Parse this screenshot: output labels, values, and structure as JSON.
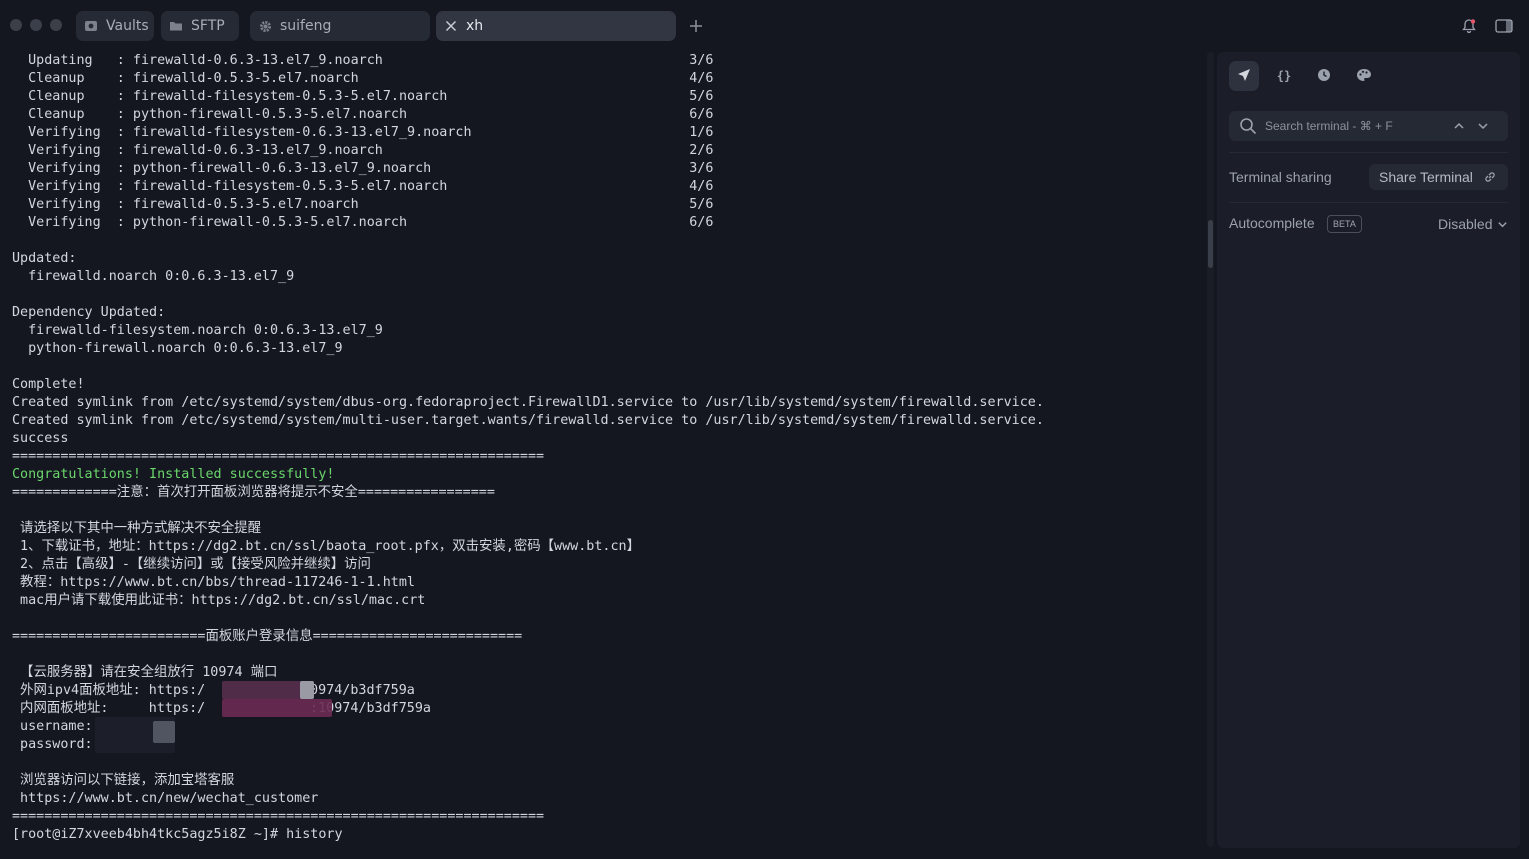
{
  "tabs": [
    {
      "label": "Vaults",
      "icon": "vault-icon"
    },
    {
      "label": "SFTP",
      "icon": "folder-icon"
    },
    {
      "label": "suifeng",
      "icon": "gear-icon"
    },
    {
      "label": "xh",
      "icon": "close-icon",
      "active": true
    }
  ],
  "terminal": {
    "lines": [
      {
        "text": "  Updating   : firewalld-0.6.3-13.el7_9.noarch                                      3/6"
      },
      {
        "text": "  Cleanup    : firewalld-0.5.3-5.el7.noarch                                         4/6"
      },
      {
        "text": "  Cleanup    : firewalld-filesystem-0.5.3-5.el7.noarch                              5/6"
      },
      {
        "text": "  Cleanup    : python-firewall-0.5.3-5.el7.noarch                                   6/6"
      },
      {
        "text": "  Verifying  : firewalld-filesystem-0.6.3-13.el7_9.noarch                           1/6"
      },
      {
        "text": "  Verifying  : firewalld-0.6.3-13.el7_9.noarch                                      2/6"
      },
      {
        "text": "  Verifying  : python-firewall-0.6.3-13.el7_9.noarch                                3/6"
      },
      {
        "text": "  Verifying  : firewalld-filesystem-0.5.3-5.el7.noarch                              4/6"
      },
      {
        "text": "  Verifying  : firewalld-0.5.3-5.el7.noarch                                         5/6"
      },
      {
        "text": "  Verifying  : python-firewall-0.5.3-5.el7.noarch                                   6/6"
      },
      {
        "text": ""
      },
      {
        "text": "Updated:"
      },
      {
        "text": "  firewalld.noarch 0:0.6.3-13.el7_9"
      },
      {
        "text": ""
      },
      {
        "text": "Dependency Updated:"
      },
      {
        "text": "  firewalld-filesystem.noarch 0:0.6.3-13.el7_9"
      },
      {
        "text": "  python-firewall.noarch 0:0.6.3-13.el7_9"
      },
      {
        "text": ""
      },
      {
        "text": "Complete!"
      },
      {
        "text": "Created symlink from /etc/systemd/system/dbus-org.fedoraproject.FirewallD1.service to /usr/lib/systemd/system/firewalld.service."
      },
      {
        "text": "Created symlink from /etc/systemd/system/multi-user.target.wants/firewalld.service to /usr/lib/systemd/system/firewalld.service."
      },
      {
        "text": "success"
      },
      {
        "text": "=================================================================="
      },
      {
        "text": "Congratulations! Installed successfully!",
        "color": "#6bd66b"
      },
      {
        "text": "=============注意：首次打开面板浏览器将提示不安全================="
      },
      {
        "text": ""
      },
      {
        "text": " 请选择以下其中一种方式解决不安全提醒"
      },
      {
        "text": " 1、下载证书，地址：https://dg2.bt.cn/ssl/baota_root.pfx，双击安装,密码【www.bt.cn】"
      },
      {
        "text": " 2、点击【高级】-【继续访问】或【接受风险并继续】访问"
      },
      {
        "text": " 教程：https://www.bt.cn/bbs/thread-117246-1-1.html"
      },
      {
        "text": " mac用户请下载使用此证书：https://dg2.bt.cn/ssl/mac.crt"
      },
      {
        "text": ""
      },
      {
        "text": "========================面板账户登录信息=========================="
      },
      {
        "text": ""
      },
      {
        "text": " 【云服务器】请在安全组放行 10974 端口"
      },
      {
        "text": " 外网ipv4面板地址: https:/            10974/b3df759a"
      },
      {
        "text": " 内网面板地址:     https:/             :10974/b3df759a"
      },
      {
        "text": " username:"
      },
      {
        "text": " password:"
      },
      {
        "text": ""
      },
      {
        "text": " 浏览器访问以下链接，添加宝塔客服"
      },
      {
        "text": " https://www.bt.cn/new/wechat_customer"
      },
      {
        "text": "=================================================================="
      },
      {
        "text": "[root@iZ7xveeb4bh4tkc5agz5i8Z ~]# history"
      }
    ]
  },
  "panel": {
    "tools": [
      "rocket-icon",
      "braces-icon",
      "history-icon",
      "palette-icon"
    ],
    "search_placeholder": "Search terminal - ⌘ + F",
    "sharing_label": "Terminal sharing",
    "share_button": "Share Terminal",
    "autocomplete_label": "Autocomplete",
    "beta_badge": "BETA",
    "autocomplete_value": "Disabled"
  },
  "colors": {
    "background": "#141720",
    "panel": "#1b1e28",
    "success_green": "#6bd66b"
  }
}
